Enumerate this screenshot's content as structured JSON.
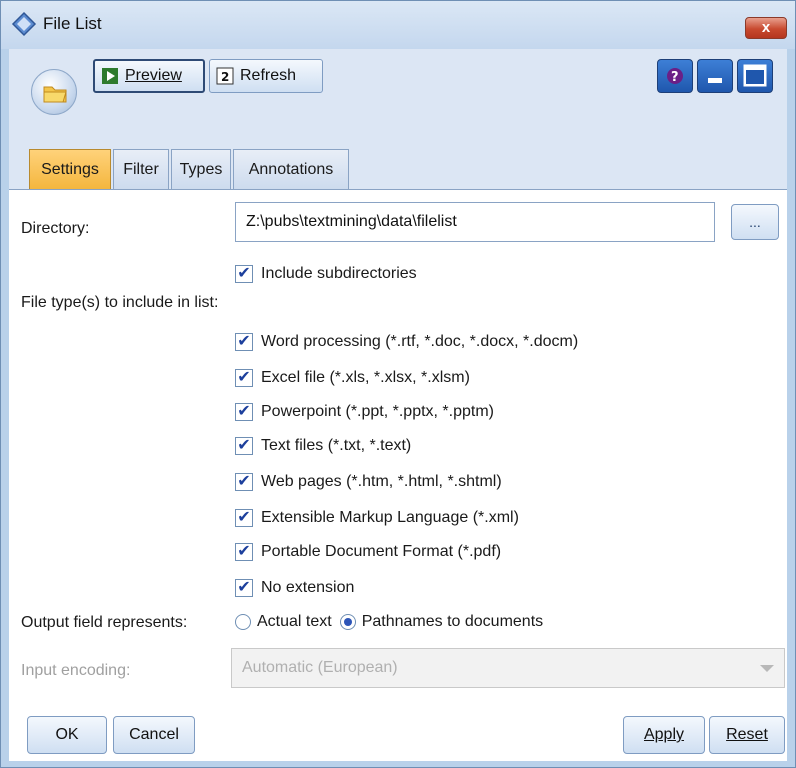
{
  "window": {
    "title": "File List",
    "close_label": "x"
  },
  "toolbar": {
    "preview_label": "Preview",
    "refresh_label": "Refresh",
    "help_label": "?"
  },
  "tabs": [
    {
      "label": "Settings",
      "active": true
    },
    {
      "label": "Filter"
    },
    {
      "label": "Types"
    },
    {
      "label": "Annotations"
    }
  ],
  "settings": {
    "directory_label": "Directory:",
    "directory_value": "Z:\\pubs\\textmining\\data\\filelist",
    "browse_label": "...",
    "include_subdirs_label": "Include subdirectories",
    "file_types_label": "File type(s) to include in list:",
    "file_types": [
      {
        "label": "Word processing (*.rtf, *.doc, *.docx, *.docm)",
        "checked": true
      },
      {
        "label": "Excel file (*.xls, *.xlsx, *.xlsm)",
        "checked": true
      },
      {
        "label": "Powerpoint (*.ppt, *.pptx, *.pptm)",
        "checked": true
      },
      {
        "label": "Text files (*.txt, *.text)",
        "checked": true
      },
      {
        "label": "Web pages (*.htm, *.html, *.shtml)",
        "checked": true
      },
      {
        "label": "Extensible Markup Language (*.xml)",
        "checked": true
      },
      {
        "label": "Portable Document Format (*.pdf)",
        "checked": true
      },
      {
        "label": "No extension",
        "checked": true
      }
    ],
    "output_label": "Output field represents:",
    "output_options": [
      {
        "label": "Actual text",
        "checked": false
      },
      {
        "label": "Pathnames to documents",
        "checked": true
      }
    ],
    "encoding_label": "Input encoding:",
    "encoding_value": "Automatic (European)"
  },
  "buttons": {
    "ok": "OK",
    "cancel": "Cancel",
    "apply": "Apply",
    "reset": "Reset"
  },
  "colors": {
    "accent_tab": "#f4b63e",
    "checkmark": "#1c3f9c",
    "close_button": "#c8492f"
  }
}
